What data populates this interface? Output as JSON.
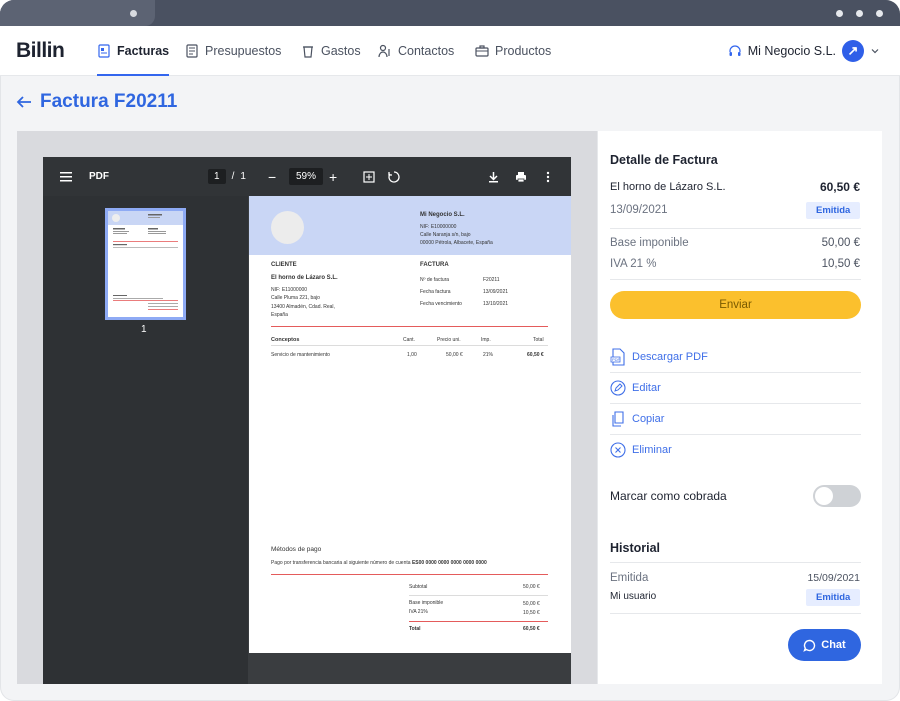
{
  "app": {
    "logo": "Billin"
  },
  "nav": {
    "items": [
      {
        "label": "Facturas",
        "icon": "invoice-icon",
        "active": true
      },
      {
        "label": "Presupuestos",
        "icon": "quote-icon",
        "active": false
      },
      {
        "label": "Gastos",
        "icon": "cup-icon",
        "active": false
      },
      {
        "label": "Contactos",
        "icon": "contacts-icon",
        "active": false
      },
      {
        "label": "Productos",
        "icon": "briefcase-icon",
        "active": false
      }
    ],
    "business": "Mi Negocio S.L."
  },
  "page": {
    "title": "Factura F20211"
  },
  "pdf": {
    "label": "PDF",
    "page_current": "1",
    "page_total": "1",
    "zoom": "59%",
    "thumb_page": "1",
    "doc": {
      "company_name": "Mi Negocio S.L.",
      "company_nif": "NIF: E10000000",
      "company_address": "Calle Naranja s/n, bajo",
      "company_city": "00000 Pétrola, Albacete, España",
      "client_heading": "CLIENTE",
      "client_name": "El horno de Lázaro S.L.",
      "client_nif": "NIF: E11000000",
      "client_address": "Calle Pluma 221, bajo",
      "client_city": "13400 Almadén, Cdad. Real,",
      "client_country": "España",
      "invoice_heading": "FACTURA",
      "invoice_number_label": "Nº de factura",
      "invoice_number": "F20211",
      "invoice_date_label": "Fecha factura",
      "invoice_date": "13/09/2021",
      "invoice_due_label": "Fecha vencimiento",
      "invoice_due": "13/10/2021",
      "col_concepts": "Conceptos",
      "col_qty": "Cant.",
      "col_price": "Precio uni.",
      "col_tax": "Imp.",
      "col_total": "Total",
      "line_desc": "Servicio de mantenimiento",
      "line_qty": "1,00",
      "line_price": "50,00 €",
      "line_tax": "21%",
      "line_total": "60,50 €",
      "payment_heading": "Métodos de pago",
      "payment_text": "Pago por transferencia bancaria al siguiente número de cuenta",
      "payment_account": "ES00 0000 0000 0000 0000 0000",
      "subtotal_label": "Subtotal",
      "subtotal": "50,00 €",
      "base_label": "Base imponible",
      "base": "50,00 €",
      "iva_label": "IVA 21%",
      "iva": "10,50 €",
      "total_label": "Total",
      "total": "60,50 €"
    }
  },
  "details": {
    "heading": "Detalle de Factura",
    "client": "El horno de Lázaro S.L.",
    "amount": "60,50 €",
    "date": "13/09/2021",
    "status": "Emitida",
    "base_label": "Base imponible",
    "base": "50,00 €",
    "iva_label": "IVA 21 %",
    "iva": "10,50 €",
    "send_label": "Enviar",
    "actions": [
      {
        "label": "Descargar PDF",
        "icon": "pdf-icon"
      },
      {
        "label": "Editar",
        "icon": "edit-icon"
      },
      {
        "label": "Copiar",
        "icon": "copy-icon"
      },
      {
        "label": "Eliminar",
        "icon": "delete-icon"
      }
    ],
    "mark_paid_label": "Marcar como cobrada",
    "mark_paid": false,
    "history_heading": "Historial",
    "history_event": "Emitida",
    "history_date": "15/09/2021",
    "history_user": "Mi usuario",
    "history_status": "Emitida",
    "chat_label": "Chat"
  },
  "colors": {
    "accent": "#2f66e0",
    "send": "#fbc02d",
    "pdf_band": "#c9d6f5",
    "chrome": "#4a5161"
  }
}
